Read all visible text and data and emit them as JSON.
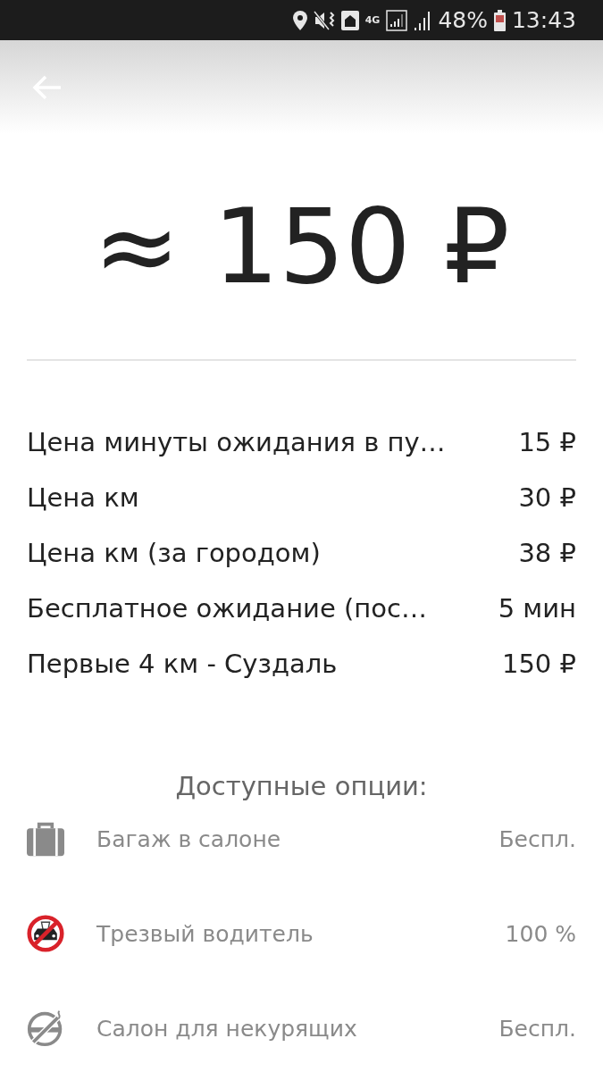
{
  "status_bar": {
    "network": "4G",
    "battery": "48%",
    "time": "13:43"
  },
  "price": "≈ 150 ₽",
  "tariff": [
    {
      "label": "Цена минуты ожидания в пу…",
      "value": "15 ₽"
    },
    {
      "label": "Цена км",
      "value": "30 ₽"
    },
    {
      "label": "Цена км (за городом)",
      "value": "38 ₽"
    },
    {
      "label": "Бесплатное ожидание (пос…",
      "value": "5 мин"
    },
    {
      "label": "Первые 4 км - Суздаль",
      "value": "150 ₽"
    }
  ],
  "options_title": "Доступные опции:",
  "options": [
    {
      "label": "Багаж в салоне",
      "value": "Беспл."
    },
    {
      "label": "Трезвый водитель",
      "value": "100 %"
    },
    {
      "label": "Салон для некурящих",
      "value": "Беспл."
    }
  ]
}
